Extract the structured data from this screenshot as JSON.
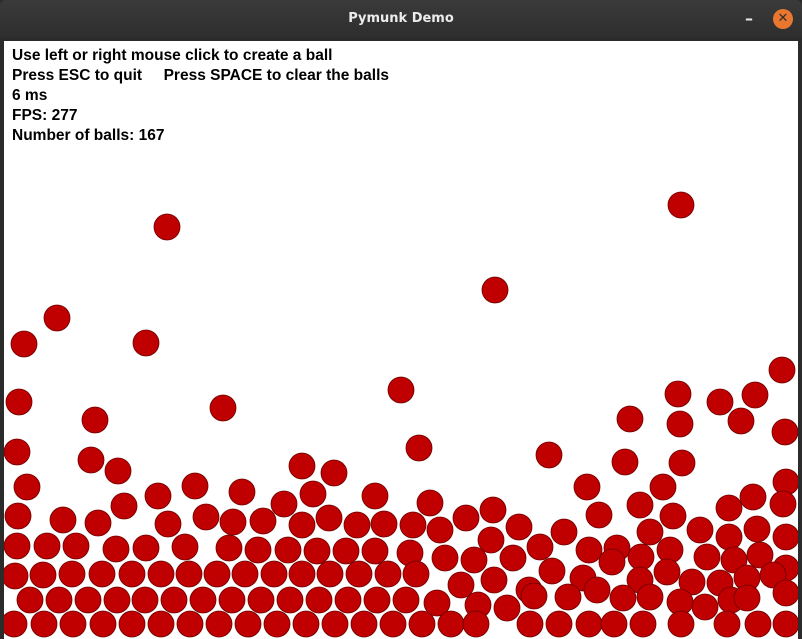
{
  "window": {
    "title": "Pymunk Demo",
    "minimize_icon": "minimize-icon",
    "close_icon": "close-icon",
    "accent_close": "#e9772f"
  },
  "info": {
    "line1": "Use left or right mouse click to create a ball",
    "line2": "Press ESC to quit     Press SPACE to clear the balls",
    "line3": "6 ms",
    "line4": "FPS: 277",
    "line5": "Number of balls: 167"
  },
  "scene": {
    "ball_color": "#c00000",
    "ball_outline": "#6a0000"
  }
}
